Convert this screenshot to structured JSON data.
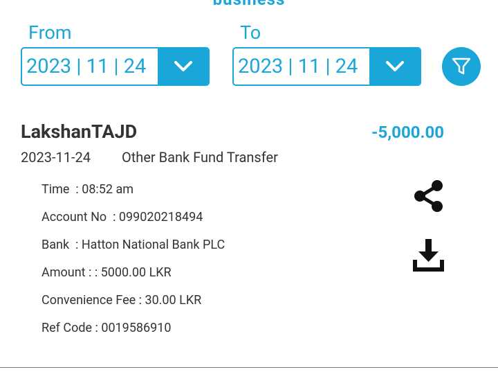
{
  "header": {
    "partial_title": "business"
  },
  "filter": {
    "from_label": "From",
    "to_label": "To",
    "from_date": "2023 | 11 | 24",
    "to_date": "2023 | 11 | 24",
    "filter_icon": "filter-icon"
  },
  "transaction": {
    "name": "LakshanTAJD",
    "amount": "-5,000.00",
    "date": "2023-11-24",
    "type": "Other Bank Fund Transfer",
    "details": [
      "Time  : 08:52 am",
      "Account No  : 099020218494",
      "Bank  : Hatton National Bank PLC",
      "Amount : : 5000.00 LKR",
      "Convenience Fee : 30.00 LKR",
      "Ref Code : 0019586910"
    ]
  },
  "actions": {
    "share_icon": "share-icon",
    "download_icon": "download-icon"
  },
  "colors": {
    "accent": "#1aa6d8",
    "text": "#333333",
    "icon": "#111111"
  }
}
